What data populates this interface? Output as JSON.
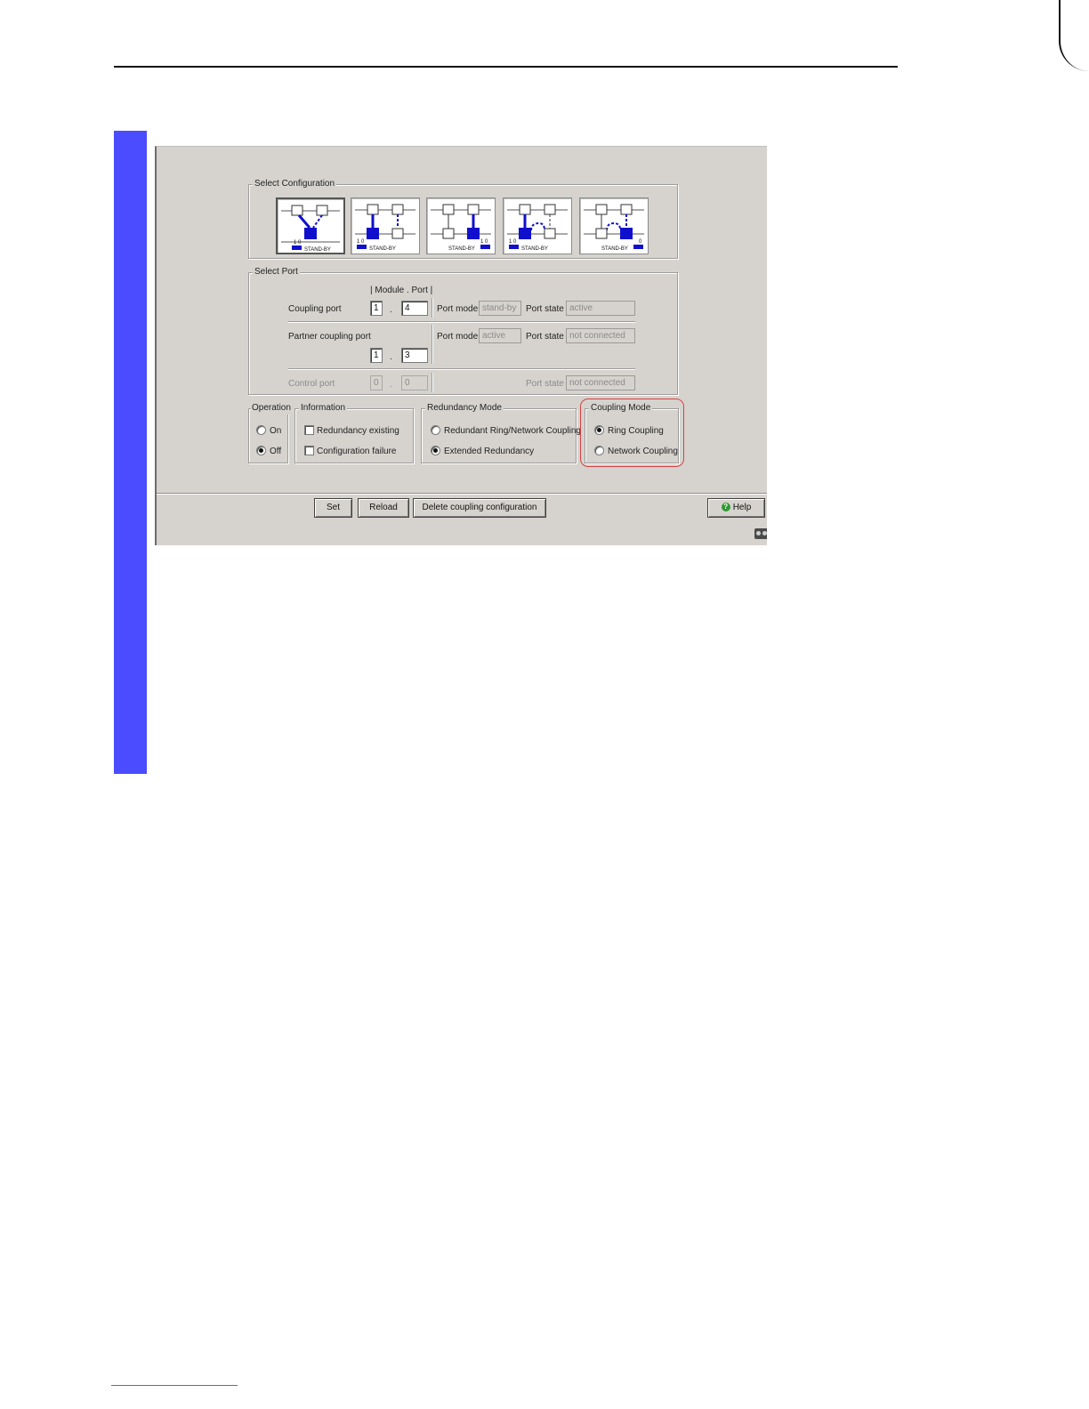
{
  "select_configuration": {
    "title": "Select Configuration",
    "thumbnails": [
      {
        "caption": "STAND-BY",
        "leds": "1 0",
        "selected": true
      },
      {
        "caption": "STAND-BY",
        "leds": "1 0",
        "selected": false
      },
      {
        "caption": "STAND-BY",
        "leds": "1 0",
        "selected": false
      },
      {
        "caption": "STAND-BY",
        "leds": "1 0",
        "selected": false
      },
      {
        "caption": "STAND-BY",
        "leds": "0",
        "selected": false
      }
    ]
  },
  "select_port": {
    "title": "Select Port",
    "header": "| Module . Port |",
    "dot": ".",
    "labels": {
      "port_mode": "Port mode",
      "port_state": "Port state"
    },
    "coupling_port": {
      "label": "Coupling port",
      "module": "1",
      "port": "4",
      "port_mode": "stand-by",
      "port_state": "active"
    },
    "partner_coupling_port": {
      "label": "Partner coupling port",
      "module": "1",
      "port": "3",
      "port_mode": "active",
      "port_state": "not connected"
    },
    "control_port": {
      "label": "Control port",
      "module": "0",
      "port": "0",
      "port_state": "not connected"
    }
  },
  "operation": {
    "title": "Operation",
    "on": "On",
    "off": "Off",
    "selected": "Off"
  },
  "information": {
    "title": "Information",
    "redundancy_existing": "Redundancy existing",
    "configuration_failure": "Configuration failure"
  },
  "redundancy_mode": {
    "title": "Redundancy Mode",
    "option1": "Redundant Ring/Network Coupling",
    "option2": "Extended Redundancy",
    "selected": "Extended Redundancy"
  },
  "coupling_mode": {
    "title": "Coupling Mode",
    "option1": "Ring Coupling",
    "option2": "Network Coupling",
    "selected": "Ring Coupling"
  },
  "buttons": {
    "set": "Set",
    "reload": "Reload",
    "delete": "Delete coupling configuration",
    "help": "Help"
  },
  "colors": {
    "side_bar": "#4b4bff",
    "window_bg": "#d6d3ce",
    "highlight": "#d84040",
    "switch_active": "#1010cc"
  }
}
